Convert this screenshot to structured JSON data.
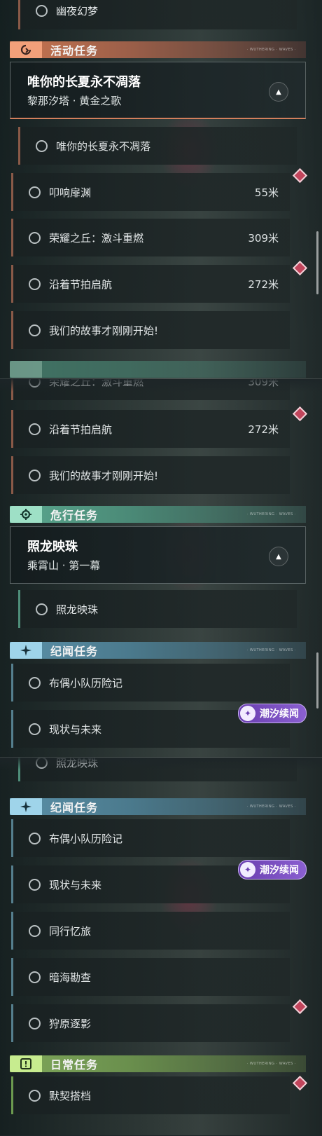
{
  "sections": {
    "activity": {
      "title": "活动任务",
      "icon": "activity-swirl-icon",
      "color": "#c87550"
    },
    "danger": {
      "title": "危行任务",
      "icon": "danger-gear-icon",
      "color": "#5aa88f"
    },
    "story": {
      "title": "纪闻任务",
      "icon": "sparkle-icon",
      "color": "#5b90a8"
    },
    "daily": {
      "title": "日常任务",
      "icon": "exclamation-icon",
      "color": "#7fa85a"
    }
  },
  "header_subtext": "· WUTHERING · WAVES ·",
  "activity_card": {
    "title": "唯你的长夏永不凋落",
    "subtitle": "黎那汐塔 · 黄金之歌"
  },
  "danger_card": {
    "title": "照龙映珠",
    "subtitle": "乘霄山 · 第一幕"
  },
  "quests": {
    "youye": "幽夜幻梦",
    "weini": "唯你的长夏永不凋落",
    "koumian": "叩响扉渊",
    "rongyao": "荣耀之丘：激斗重燃",
    "yanzhe": "沿着节拍启航",
    "gushi": "我们的故事才刚刚开始!",
    "zhaolong": "照龙映珠",
    "buou": "布偶小队历险记",
    "xianzhuang": "现状与未来",
    "tongxing": "同行忆旅",
    "anhai": "暗海勘查",
    "shouyuan": "狩原逐影",
    "moqi": "默契搭档"
  },
  "distances": {
    "koumian": "55米",
    "rongyao": "309米",
    "yanzhe": "272米"
  },
  "badge": {
    "label": "潮汐续闻",
    "icon": "tide-story-icon"
  }
}
